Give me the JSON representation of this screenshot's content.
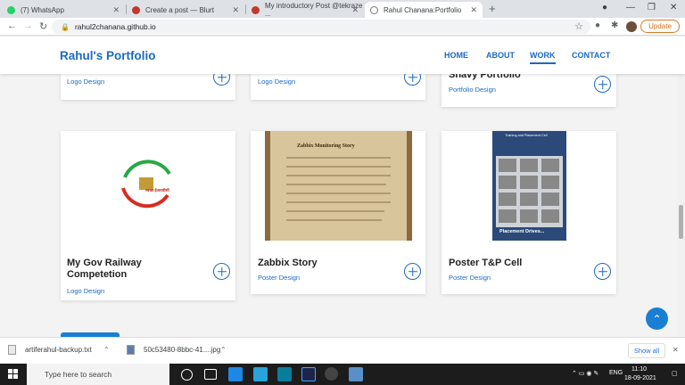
{
  "browser": {
    "tabs": [
      {
        "title": "(7) WhatsApp",
        "color": "#25d366"
      },
      {
        "title": "Create a post — Blurt",
        "color": "#c0392b"
      },
      {
        "title": "My introductory Post @tekraze ...",
        "color": "#c0392b"
      },
      {
        "title": "Rahul Chanana:Portfolio",
        "color": "#777777"
      }
    ],
    "new_tab": "+",
    "url": "rahul2chanana.github.io",
    "update_label": "Update"
  },
  "site": {
    "logo": "Rahul's Portfolio",
    "nav": [
      "HOME",
      "ABOUT",
      "WORK",
      "CONTACT"
    ],
    "active_nav": "WORK",
    "accent": "#1b6bbf"
  },
  "portfolio": {
    "top_row": [
      {
        "title": "",
        "category": "Logo Design"
      },
      {
        "title": "",
        "category": "Logo Design"
      },
      {
        "title": "Shavy Portfolio",
        "category": "Portfolio Design"
      }
    ],
    "bottom_row": [
      {
        "title": "My Gov Railway Competetion",
        "title_line1": "My Gov Railway",
        "title_line2": "Competetion",
        "category": "Logo Design",
        "image_text": "स्वच्छ ईआरडीसी"
      },
      {
        "title": "Zabbix Story",
        "category": "Poster Design",
        "image_text": "Zabbix Monitoring Story"
      },
      {
        "title": "Poster T&P Cell",
        "category": "Poster Design",
        "image_text": "Placement Drives...",
        "image_header": "Training and Placement Cell"
      }
    ]
  },
  "downloads": [
    {
      "name": "artiferahul-backup.txt"
    },
    {
      "name": "50c53480-8bbc-41....jpg"
    }
  ],
  "show_all": "Show all",
  "taskbar": {
    "search_placeholder": "Type here to search",
    "time": "11:10",
    "date": "18-09-2021",
    "lang": "ENG"
  }
}
